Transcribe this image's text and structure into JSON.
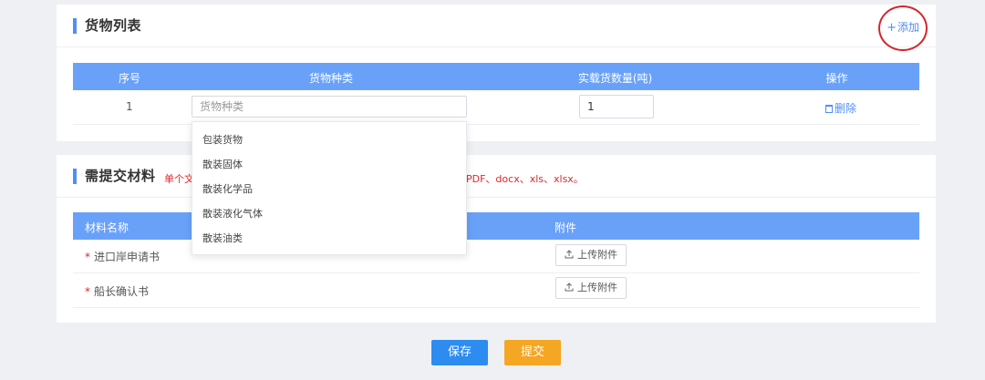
{
  "goods_section": {
    "title": "货物列表",
    "add_icon": "+",
    "add_label": "添加",
    "columns": [
      "序号",
      "货物种类",
      "实载货数量(吨)",
      "操作"
    ],
    "rows": [
      {
        "index": "1",
        "cargo_type_value": "",
        "cargo_type_placeholder": "货物种类",
        "quantity_value": "1",
        "delete_label": "删除"
      }
    ],
    "dropdown_options": [
      "包装货物",
      "散装固体",
      "散装化学品",
      "散装液化气体",
      "散装油类"
    ]
  },
  "materials_section": {
    "title": "需提交材料",
    "note_left": "单个文",
    "note_right": "PDF、docx、xls、xlsx。",
    "columns": [
      "材料名称",
      "附件"
    ],
    "rows": [
      {
        "required_mark": "*",
        "name": "进口岸申请书",
        "upload_label": "上传附件"
      },
      {
        "required_mark": "*",
        "name": "船长确认书",
        "upload_label": "上传附件"
      }
    ]
  },
  "actions": {
    "save_label": "保存",
    "submit_label": "提交"
  },
  "colors": {
    "accent": "#4f8ef7",
    "table_header": "#69a1f9",
    "save_button": "#2d8cf0",
    "submit_button": "#f5a623",
    "required": "#e0262b",
    "annotation_circle": "#d6262b"
  },
  "icons": {
    "title_marker": "title-bar-icon",
    "add": "plus-icon",
    "delete": "trash-icon",
    "upload": "upload-icon"
  }
}
